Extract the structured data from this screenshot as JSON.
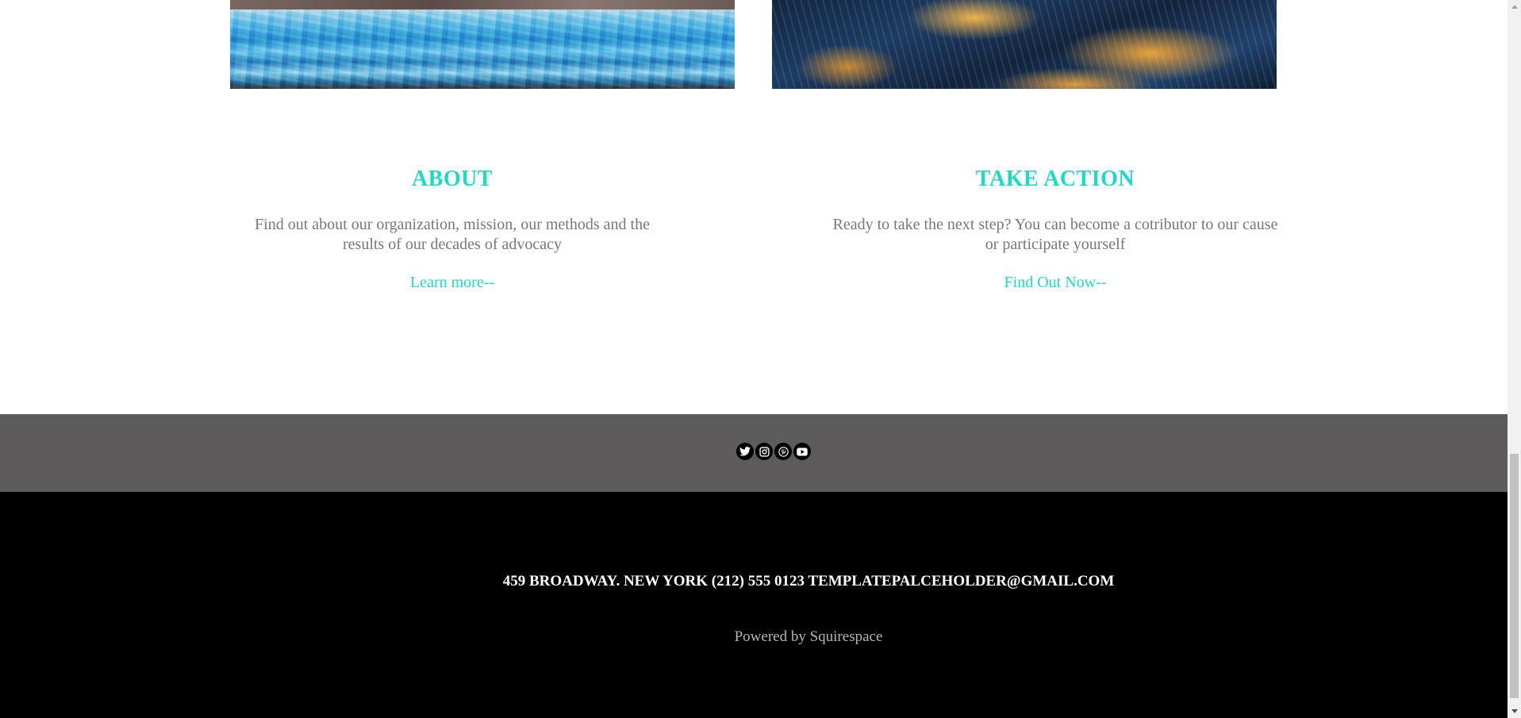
{
  "columns": [
    {
      "title": "ABOUT",
      "text": "Find out about our organization, mission, our methods and the results of our decades of advocacy",
      "link": "Learn more--"
    },
    {
      "title": "TAKE ACTION",
      "text": "Ready to take the next step? You can become a cotributor to our cause or participate yourself",
      "link": "Find Out Now--"
    }
  ],
  "social": [
    "twitter-icon",
    "instagram-icon",
    "pinterest-icon",
    "youtube-icon"
  ],
  "footer": {
    "address": "459 BROADWAY. NEW YORK (212) 555 0123 TEMPLATEPALCEHOLDER@GMAIL.COM",
    "powered_by": "Powered by Squirespace"
  },
  "colors": {
    "accent": "#1fd9c6",
    "body_text": "#777777",
    "social_band": "#5d5b5c",
    "footer_bg": "#000000"
  }
}
